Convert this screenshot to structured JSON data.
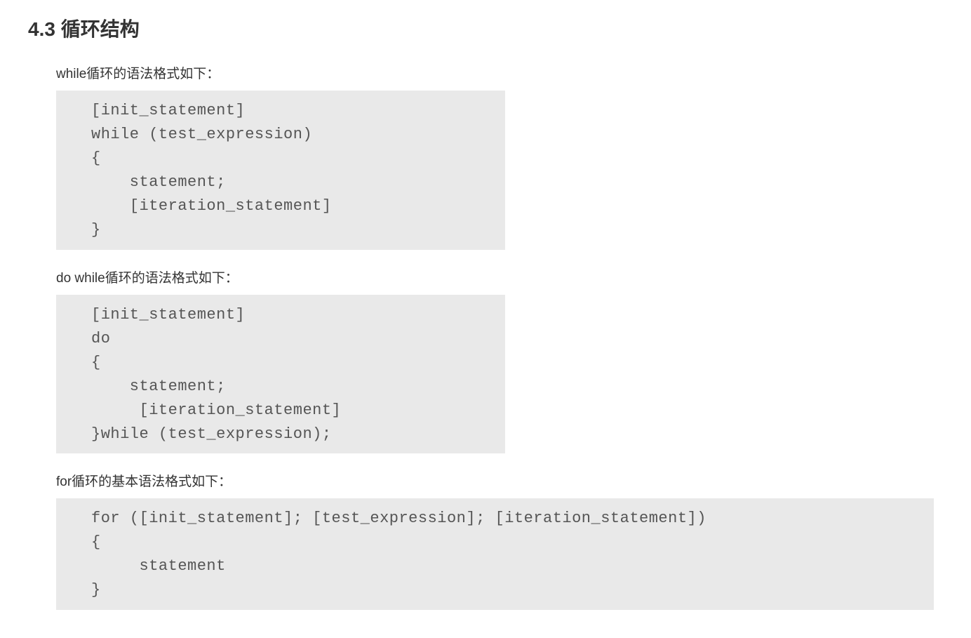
{
  "heading": "4.3 循环结构",
  "sections": [
    {
      "description": "while循环的语法格式如下：",
      "code": "[init_statement]\nwhile (test_expression)\n{\n    statement;\n    [iteration_statement]\n}",
      "narrow": true
    },
    {
      "description": "do while循环的语法格式如下：",
      "code": "[init_statement]\ndo\n{\n    statement;\n     [iteration_statement]\n}while (test_expression);",
      "narrow": true
    },
    {
      "description": "for循环的基本语法格式如下：",
      "code": "for ([init_statement]; [test_expression]; [iteration_statement])\n{\n     statement\n}",
      "narrow": false
    }
  ]
}
